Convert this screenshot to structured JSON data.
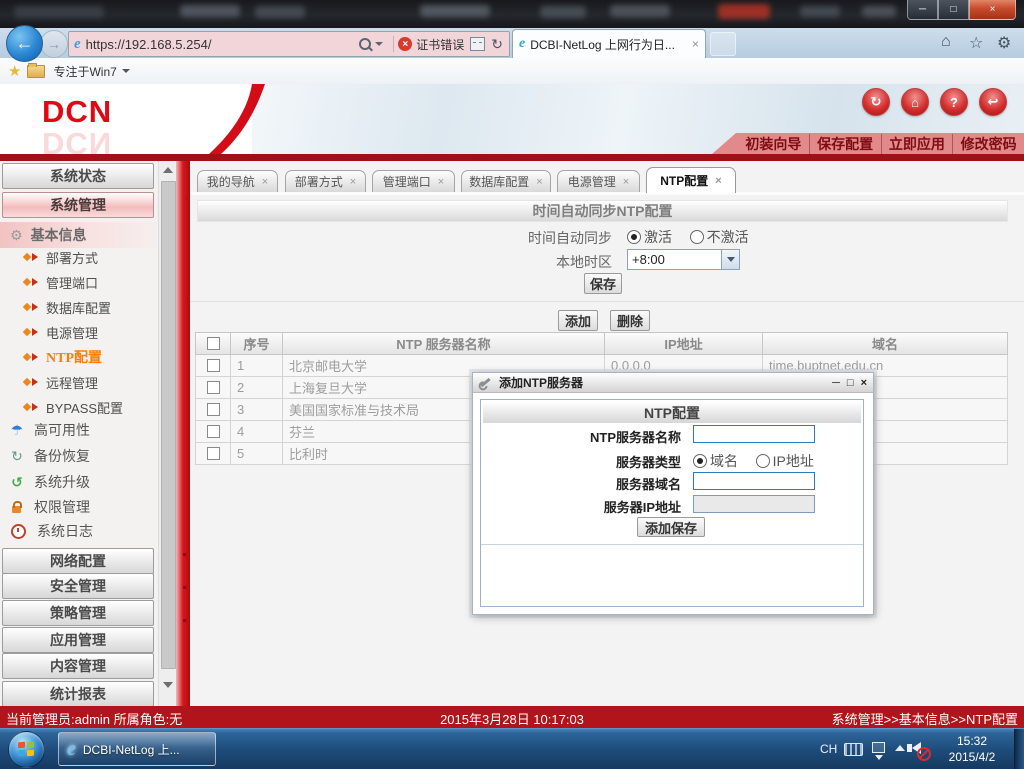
{
  "browser": {
    "url": "https://192.168.5.254/",
    "cert_error_label": "证书错误",
    "tab_title": "DCBI-NetLog 上网行为日...",
    "favorites_label": "专注于Win7",
    "ie_glyph": "e"
  },
  "brand": {
    "logo_text": "DCN"
  },
  "header_actions": {
    "labels": [
      "初装向导",
      "保存配置",
      "立即应用",
      "修改密码"
    ]
  },
  "sidebar": {
    "btn_system_status": "系统状态",
    "btn_system_mgmt": "系统管理",
    "section_basic_info": "基本信息",
    "items": [
      "部署方式",
      "管理端口",
      "数据库配置",
      "电源管理",
      "NTP配置",
      "远程管理",
      "BYPASS配置"
    ],
    "groups": [
      "高可用性",
      "备份恢复",
      "系统升级",
      "权限管理",
      "系统日志"
    ],
    "bottom": [
      "网络配置",
      "安全管理",
      "策略管理",
      "应用管理",
      "内容管理",
      "统计报表"
    ]
  },
  "tabs": {
    "labels": [
      "我的导航",
      "部署方式",
      "管理端口",
      "数据库配置",
      "电源管理",
      "NTP配置"
    ]
  },
  "form": {
    "title": "时间自动同步NTP配置",
    "sync_label": "时间自动同步",
    "opt_enable": "激活",
    "opt_disable": "不激活",
    "tz_label": "本地时区",
    "tz_value": "+8:00",
    "save_btn": "保存",
    "add_btn": "添加",
    "del_btn": "删除"
  },
  "table": {
    "col_no": "序号",
    "col_name": "NTP 服务器名称",
    "col_ip": "IP地址",
    "col_domain": "域名",
    "rows": [
      {
        "no": "1",
        "name": "北京邮电大学",
        "ip": "0.0.0.0",
        "domain": "time.buptnet.edu.cn"
      },
      {
        "no": "2",
        "name": "上海复旦大学",
        "ip": "",
        "domain": ""
      },
      {
        "no": "3",
        "name": "美国国家标准与技术局",
        "ip": "",
        "domain": ""
      },
      {
        "no": "4",
        "name": "芬兰",
        "ip": "",
        "domain": ""
      },
      {
        "no": "5",
        "name": "比利时",
        "ip": "",
        "domain": ""
      }
    ]
  },
  "dialog": {
    "title": "添加NTP服务器",
    "section_title": "NTP配置",
    "name_label": "NTP服务器名称",
    "type_label": "服务器类型",
    "type_domain": "域名",
    "type_ip": "IP地址",
    "domain_label": "服务器域名",
    "ip_label": "服务器IP地址",
    "submit_btn": "添加保存"
  },
  "status_bar": {
    "admin": "当前管理员:admin  所属角色:无",
    "datetime": "2015年3月28日  10:17:03",
    "breadcrumb": "系统管理>>基本信息>>NTP配置"
  },
  "taskbar": {
    "ie_task": "DCBI-NetLog 上...",
    "lang": "CH",
    "time": "15:32",
    "date": "2015/4/2"
  },
  "icons": {
    "back": "←",
    "forward": "→",
    "refresh": "↻",
    "cert_x": "×",
    "home": "⌂",
    "star": "☆",
    "gear": "⚙",
    "fav_star": "★",
    "tab_close": "×",
    "win_min": "─",
    "win_max": "□",
    "win_close": "×",
    "hdr_sync": "↻",
    "hdr_home": "⌂",
    "hdr_help": "?",
    "hdr_logout": "↩",
    "umbrella": "☂",
    "backup": "↻",
    "upgrade": "↺",
    "dlg_min": "─",
    "dlg_max": "□",
    "dlg_close": "×"
  },
  "colors": {
    "accent_red": "#d8151c",
    "bar_red": "#b2141b",
    "active_orange": "#ff7e00"
  }
}
